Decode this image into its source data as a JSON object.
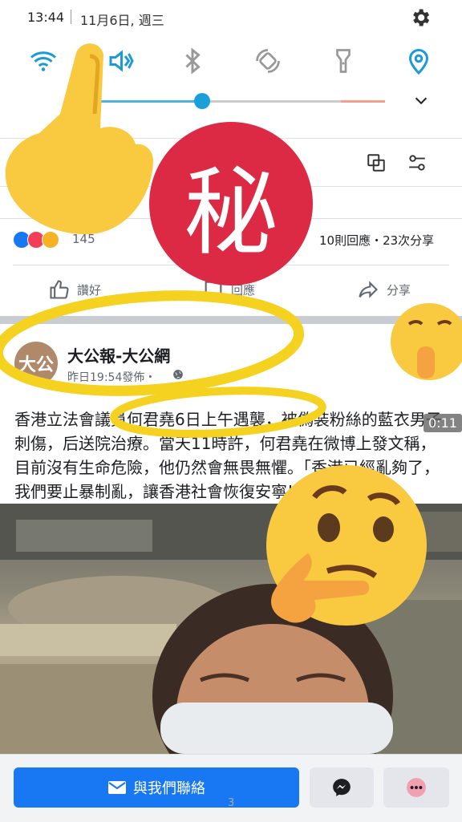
{
  "status": {
    "time": "13:44",
    "date": "11月6日, 週三"
  },
  "quick_settings": {
    "icons": [
      "wifi-icon",
      "sound-icon",
      "bluetooth-icon",
      "auto-rotate-icon",
      "flashlight-icon",
      "location-icon"
    ]
  },
  "feed": {
    "reaction_count": "145",
    "comments_shares": "10則回應・23次分享",
    "actions": {
      "like": "讚好",
      "comment": "回應",
      "share": "分享"
    }
  },
  "post": {
    "page_name": "大公報-大公網",
    "avatar_text": "大公",
    "time": "昨日19:54發佈・",
    "text": "香港立法會議員何君堯6日上午遇襲，被偽裝粉絲的藍衣男子刺傷，后送院治療。當天11時許，何君堯在微博上發文稱，目前沒有生命危險，他仍然會無畏無懼。「香港已經亂夠了，我們要止暴制亂，讓香港社會恢復安寧!」",
    "video_time": "0:11"
  },
  "bottom": {
    "contact_label": "與我們聯絡",
    "page_indicator": "3"
  },
  "overlay": {
    "secret_char": "秘"
  },
  "colors": {
    "facebook_blue": "#1877f2",
    "secret_red": "#dd2a44",
    "highlight_yellow": "#f5d21f",
    "emoji_yellow": "#f9c93f"
  }
}
